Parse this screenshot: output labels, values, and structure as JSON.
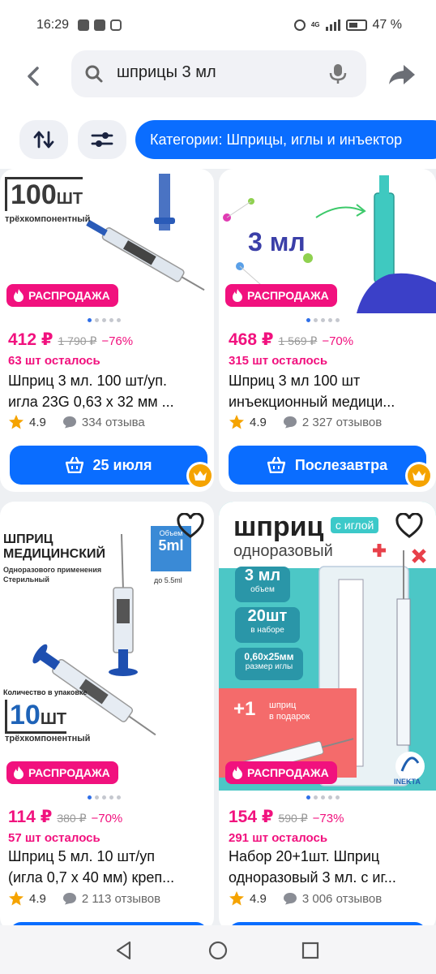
{
  "status": {
    "time": "16:29",
    "battery": "47 %",
    "network": "4G"
  },
  "search": {
    "query": "шприцы 3 мл"
  },
  "filters": {
    "category_chip": "Категории: Шприцы, иглы и инъектор"
  },
  "colors": {
    "accent": "#0a6dff",
    "sale": "#f1117e",
    "crown": "#f5a300"
  },
  "products": [
    {
      "image_text": {
        "count": "100",
        "unit": "ШТ",
        "subtitle": "трёхкомпонентный"
      },
      "badge": "РАСПРОДАЖА",
      "price": "412 ₽",
      "old_price": "1 790 ₽",
      "discount": "−76%",
      "stock": "63 шт осталось",
      "title_line1": "Шприц 3 мл. 100 шт/уп.",
      "title_line2": "игла 23G 0,63 х 32 мм ...",
      "rating": "4.9",
      "reviews": "334 отзыва",
      "button": "25 июля"
    },
    {
      "image_text": {
        "volume": "3 мл"
      },
      "badge": "РАСПРОДАЖА",
      "price": "468 ₽",
      "old_price": "1 569 ₽",
      "discount": "−70%",
      "stock": "315 шт осталось",
      "title_line1": "Шприц 3 мл 100 шт",
      "title_line2": "инъекционный медици...",
      "rating": "4.9",
      "reviews": "2 327 отзывов",
      "button": "Послезавтра"
    },
    {
      "image_text": {
        "heading1": "ШПРИЦ",
        "heading2": "МЕДИЦИНСКИЙ",
        "sub1": "Одноразового применения",
        "sub2": "Стерильный",
        "volume_label": "Объем",
        "volume": "5ml",
        "volume_note": "до 5.5ml",
        "pack_label": "Количество в упаковке",
        "count": "10",
        "unit": "ШТ",
        "subtitle": "трёхкомпонентный"
      },
      "badge": "РАСПРОДАЖА",
      "price": "114 ₽",
      "old_price": "380 ₽",
      "discount": "−70%",
      "stock": "57 шт осталось",
      "title_line1": "Шприц 5 мл. 10 шт/уп",
      "title_line2": "(игла 0,7 х 40 мм) креп...",
      "rating": "4.9",
      "reviews": "2 113 отзывов"
    },
    {
      "image_text": {
        "heading": "шприц",
        "heading_tag": "с иглой",
        "subheading": "одноразовый",
        "spec1_value": "3 мл",
        "spec1_label": "объем",
        "spec2_value": "20шт",
        "spec2_label": "в наборе",
        "spec3_value": "0,60x25мм",
        "spec3_label": "размер иглы",
        "promo_value": "+1",
        "promo_text1": "шприц",
        "promo_text2": "в подарок",
        "brand": "INEKTA"
      },
      "badge": "РАСПРОДАЖА",
      "price": "154 ₽",
      "old_price": "590 ₽",
      "discount": "−73%",
      "stock": "291 шт осталось",
      "title_line1": "Набор 20+1шт. Шприц",
      "title_line2": "одноразовый 3 мл. с иг...",
      "rating": "4.9",
      "reviews": "3 006 отзывов"
    }
  ]
}
